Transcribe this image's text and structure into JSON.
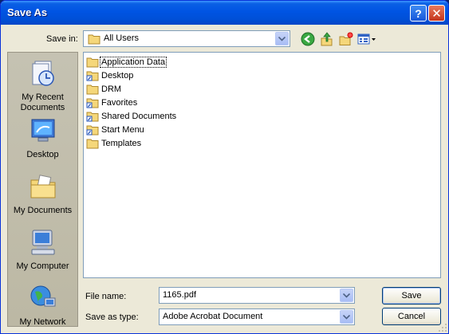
{
  "window": {
    "title": "Save As"
  },
  "titlebar": {
    "help_glyph": "?",
    "close_glyph": "✕"
  },
  "save_in": {
    "label": "Save in:",
    "value": "All Users"
  },
  "toolbar": {
    "icons": [
      "back-icon",
      "up-folder-icon",
      "new-folder-icon",
      "views-menu-icon"
    ]
  },
  "places": [
    {
      "label_lines": [
        "My Recent",
        "Documents"
      ],
      "icon": "recent-documents-icon"
    },
    {
      "label_lines": [
        "Desktop"
      ],
      "icon": "desktop-icon"
    },
    {
      "label_lines": [
        "My Documents"
      ],
      "icon": "my-documents-icon"
    },
    {
      "label_lines": [
        "My Computer"
      ],
      "icon": "my-computer-icon"
    },
    {
      "label_lines": [
        "My Network"
      ],
      "icon": "my-network-icon"
    }
  ],
  "files": [
    {
      "name": "Application Data",
      "shortcut": false
    },
    {
      "name": "Desktop",
      "shortcut": true
    },
    {
      "name": "DRM",
      "shortcut": false
    },
    {
      "name": "Favorites",
      "shortcut": true
    },
    {
      "name": "Shared Documents",
      "shortcut": true
    },
    {
      "name": "Start Menu",
      "shortcut": true
    },
    {
      "name": "Templates",
      "shortcut": false
    }
  ],
  "file_name": {
    "label": "File name:",
    "value": "1165.pdf"
  },
  "save_as_type": {
    "label": "Save as type:",
    "value": "Adobe Acrobat Document"
  },
  "buttons": {
    "save": "Save",
    "cancel": "Cancel"
  },
  "colors": {
    "titlebar": "#0054e3",
    "dialog_bg": "#ece9d8",
    "folder": "#f5d77a"
  }
}
